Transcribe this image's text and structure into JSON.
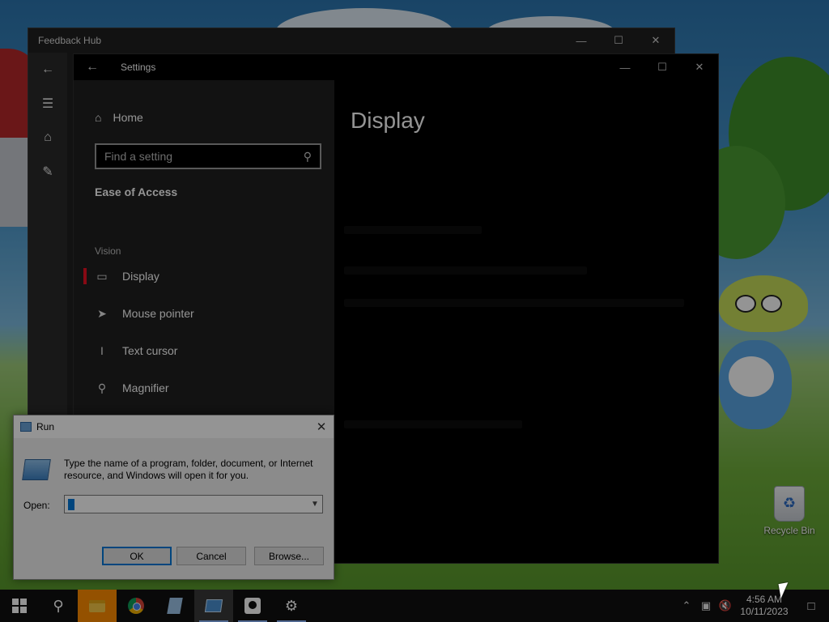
{
  "desktop": {
    "recycle_bin_label": "Recycle Bin"
  },
  "feedback_hub": {
    "title": "Feedback Hub",
    "controls": {
      "minimize": "—",
      "maximize": "☐",
      "close": "✕"
    },
    "nav_icons": [
      "back-arrow-icon",
      "hamburger-menu-icon",
      "home-icon",
      "feedback-icon"
    ]
  },
  "settings": {
    "title": "Settings",
    "back_glyph": "←",
    "controls": {
      "minimize": "—",
      "maximize": "☐",
      "close": "✕"
    },
    "home_label": "Home",
    "search_placeholder": "Find a setting",
    "section_title": "Ease of Access",
    "group_label": "Vision",
    "items": [
      {
        "label": "Display",
        "icon": "monitor-icon",
        "active": true
      },
      {
        "label": "Mouse pointer",
        "icon": "mouse-pointer-icon",
        "active": false
      },
      {
        "label": "Text cursor",
        "icon": "text-cursor-icon",
        "active": false
      },
      {
        "label": "Magnifier",
        "icon": "magnifier-icon",
        "active": false
      }
    ],
    "page_title": "Display"
  },
  "run_dialog": {
    "title": "Run",
    "close_glyph": "✕",
    "description": "Type the name of a program, folder, document, or Internet resource, and Windows will open it for you.",
    "open_label": "Open:",
    "open_value": "",
    "buttons": {
      "ok": "OK",
      "cancel": "Cancel",
      "browse": "Browse..."
    }
  },
  "taskbar": {
    "apps": [
      "start-button",
      "search-button",
      "file-explorer",
      "chrome",
      "notepad-app",
      "run-app",
      "feedback-hub-app",
      "settings-app"
    ],
    "clock_time": "4:56 AM",
    "clock_date": "10/11/2023",
    "tray_icons": [
      "chevron-up-icon",
      "network-icon",
      "volume-muted-icon",
      "action-center-icon"
    ]
  },
  "colors": {
    "accent": "#0078d7",
    "settings_active_marker": "#e81123",
    "taskbar": "#101010"
  }
}
